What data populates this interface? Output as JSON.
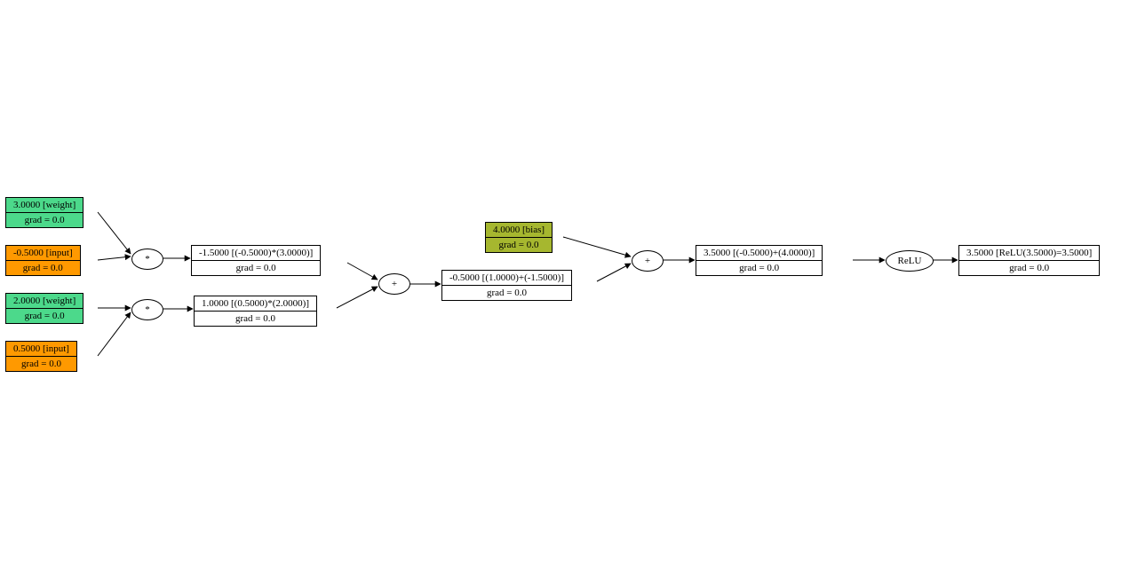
{
  "chart_data": {
    "type": "computational-graph",
    "nodes": [
      {
        "id": "w1",
        "kind": "weight",
        "value": 3.0,
        "label": "3.0000 [weight]",
        "grad": "grad = 0.0"
      },
      {
        "id": "x1",
        "kind": "input",
        "value": -0.5,
        "label": "-0.5000 [input]",
        "grad": "grad = 0.0"
      },
      {
        "id": "w2",
        "kind": "weight",
        "value": 2.0,
        "label": "2.0000 [weight]",
        "grad": "grad = 0.0"
      },
      {
        "id": "x2",
        "kind": "input",
        "value": 0.5,
        "label": "0.5000 [input]",
        "grad": "grad = 0.0"
      },
      {
        "id": "b",
        "kind": "bias",
        "value": 4.0,
        "label": "4.0000 [bias]",
        "grad": "grad = 0.0"
      },
      {
        "id": "m1",
        "kind": "result",
        "label": "-1.5000 [(-0.5000)*(3.0000)]",
        "grad": "grad = 0.0"
      },
      {
        "id": "m2",
        "kind": "result",
        "label": "1.0000 [(0.5000)*(2.0000)]",
        "grad": "grad = 0.0"
      },
      {
        "id": "s1",
        "kind": "result",
        "label": "-0.5000 [(1.0000)+(-1.5000)]",
        "grad": "grad = 0.0"
      },
      {
        "id": "s2",
        "kind": "result",
        "label": "3.5000 [(-0.5000)+(4.0000)]",
        "grad": "grad = 0.0"
      },
      {
        "id": "r",
        "kind": "result",
        "label": "3.5000 [ReLU(3.5000)=3.5000]",
        "grad": "grad = 0.0"
      }
    ],
    "ops": [
      {
        "id": "op_m1",
        "label": "*",
        "in": [
          "w1",
          "x1"
        ],
        "out": "m1"
      },
      {
        "id": "op_m2",
        "label": "*",
        "in": [
          "w2",
          "x2"
        ],
        "out": "m2"
      },
      {
        "id": "op_a1",
        "label": "+",
        "in": [
          "m1",
          "m2"
        ],
        "out": "s1"
      },
      {
        "id": "op_a2",
        "label": "+",
        "in": [
          "b",
          "s1"
        ],
        "out": "s2"
      },
      {
        "id": "op_relu",
        "label": "ReLU",
        "in": [
          "s2"
        ],
        "out": "r"
      }
    ]
  },
  "labels": {
    "w1_top": "3.0000 [weight]",
    "w1_bot": "grad = 0.0",
    "x1_top": "-0.5000 [input]",
    "x1_bot": "grad = 0.0",
    "w2_top": "2.0000 [weight]",
    "w2_bot": "grad = 0.0",
    "x2_top": "0.5000 [input]",
    "x2_bot": "grad = 0.0",
    "b_top": "4.0000 [bias]",
    "b_bot": "grad = 0.0",
    "m1_top": "-1.5000 [(-0.5000)*(3.0000)]",
    "m1_bot": "grad = 0.0",
    "m2_top": "1.0000 [(0.5000)*(2.0000)]",
    "m2_bot": "grad = 0.0",
    "s1_top": "-0.5000 [(1.0000)+(-1.5000)]",
    "s1_bot": "grad = 0.0",
    "s2_top": "3.5000 [(-0.5000)+(4.0000)]",
    "s2_bot": "grad = 0.0",
    "r_top": "3.5000 [ReLU(3.5000)=3.5000]",
    "r_bot": "grad = 0.0",
    "op_mul": "*",
    "op_add": "+",
    "op_relu": "ReLU"
  }
}
